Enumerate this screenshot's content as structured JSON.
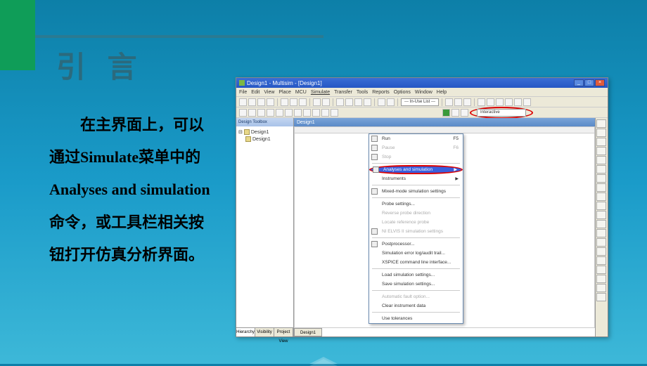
{
  "slide": {
    "title": "引 言",
    "body": "在主界面上，可以通过Simulate菜单中的Analyses and simulation命令，或工具栏相关按钮打开仿真分析界面。"
  },
  "window": {
    "title": "Design1 - Multisim - [Design1]",
    "buttons": {
      "min": "_",
      "max": "□",
      "close": "×"
    }
  },
  "menubar": [
    "File",
    "Edit",
    "View",
    "Place",
    "MCU",
    "Simulate",
    "Transfer",
    "Tools",
    "Reports",
    "Options",
    "Window",
    "Help"
  ],
  "toolbar": {
    "in_use": "--- In-Use List ---",
    "interactive": "Interactive"
  },
  "sidebar": {
    "header": "Design Toolbox",
    "tree": {
      "root": "Design1",
      "child": "Design1"
    },
    "tabs": [
      "Hierarchy",
      "Visibility",
      "Project View"
    ]
  },
  "document": {
    "title": "Design1",
    "tab": "Design1"
  },
  "simulate_menu": {
    "items": [
      {
        "label": "Run",
        "key": "F5",
        "icon": true
      },
      {
        "label": "Pause",
        "key": "F6",
        "icon": true,
        "disabled": true
      },
      {
        "label": "Stop",
        "icon": true,
        "disabled": true
      },
      {
        "sep": true
      },
      {
        "label": "Analyses and simulation",
        "icon": true,
        "highlighted": true,
        "submenu": true
      },
      {
        "label": "Instruments",
        "submenu": true
      },
      {
        "sep": true
      },
      {
        "label": "Mixed-mode simulation settings",
        "icon": true
      },
      {
        "sep": true
      },
      {
        "label": "Probe settings..."
      },
      {
        "label": "Reverse probe direction",
        "disabled": true
      },
      {
        "label": "Locate reference probe",
        "disabled": true
      },
      {
        "label": "NI ELVIS II simulation settings",
        "disabled": true,
        "icon": true
      },
      {
        "sep": true
      },
      {
        "label": "Postprocessor...",
        "icon": true
      },
      {
        "label": "Simulation error log/audit trail..."
      },
      {
        "label": "XSPICE command line interface..."
      },
      {
        "sep": true
      },
      {
        "label": "Load simulation settings..."
      },
      {
        "label": "Save simulation settings..."
      },
      {
        "sep": true
      },
      {
        "label": "Automatic fault option...",
        "disabled": true
      },
      {
        "label": "Clear instrument data"
      },
      {
        "sep": true
      },
      {
        "label": "Use tolerances"
      }
    ]
  }
}
